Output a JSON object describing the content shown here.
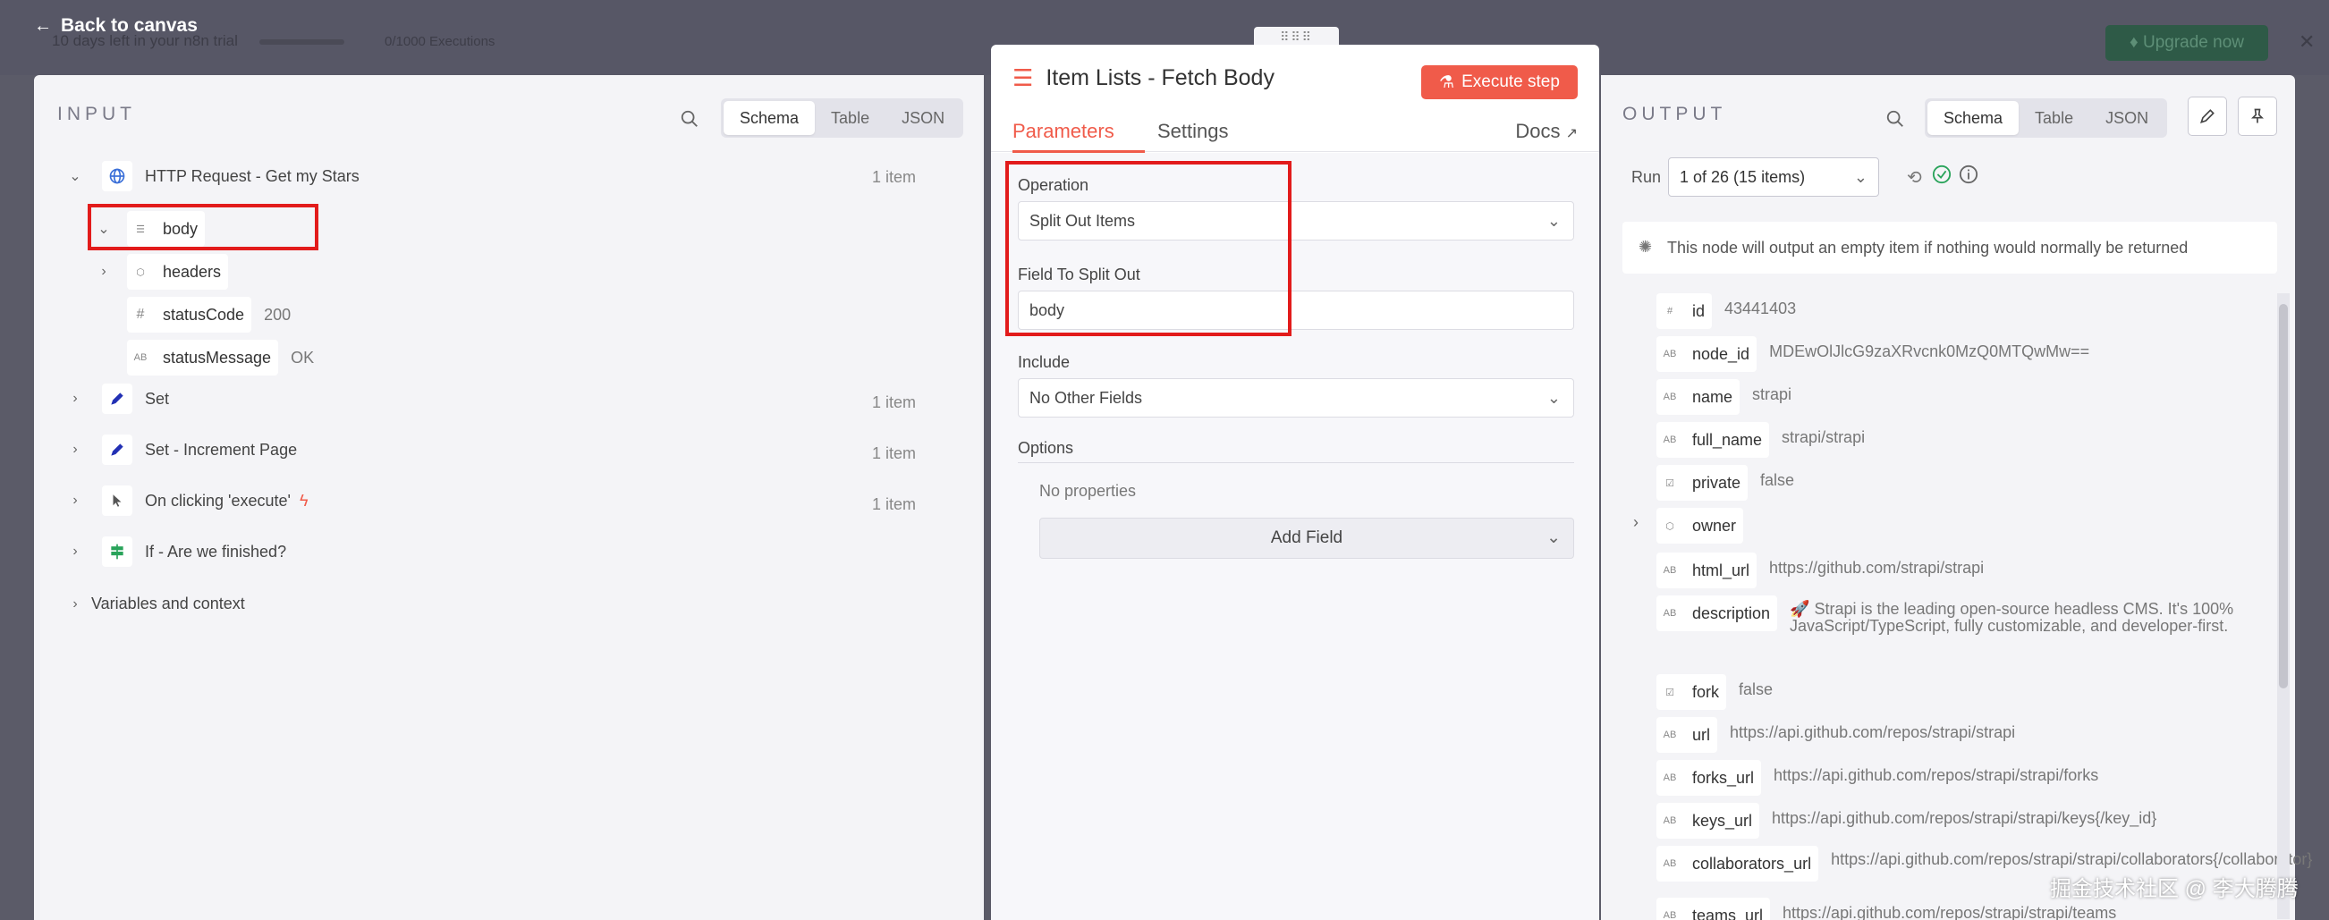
{
  "background": {
    "trial_text": "10 days left in your n8n trial",
    "executions_text": "0/1000 Executions",
    "upgrade_label": "Upgrade now"
  },
  "back_label": "Back to canvas",
  "input": {
    "title": "INPUT",
    "view_tabs": [
      "Schema",
      "Table",
      "JSON"
    ],
    "nodes": [
      {
        "name": "HTTP Request - Get my Stars",
        "count": "1 item"
      },
      {
        "name": "Set",
        "count": "1 item"
      },
      {
        "name": "Set - Increment Page",
        "count": "1 item"
      },
      {
        "name": "On clicking 'execute'",
        "count": "1 item"
      },
      {
        "name": "If - Are we finished?",
        "count": ""
      }
    ],
    "fields": [
      {
        "name": "body",
        "value": ""
      },
      {
        "name": "headers",
        "value": ""
      },
      {
        "name": "statusCode",
        "value": "200"
      },
      {
        "name": "statusMessage",
        "value": "OK"
      }
    ],
    "variables_label": "Variables and context"
  },
  "node": {
    "title": "Item Lists - Fetch Body",
    "execute_label": "Execute step",
    "tabs": [
      "Parameters",
      "Settings"
    ],
    "docs_label": "Docs",
    "operation_label": "Operation",
    "operation_value": "Split Out Items",
    "field_label": "Field To Split Out",
    "field_value": "body",
    "include_label": "Include",
    "include_value": "No Other Fields",
    "options_label": "Options",
    "no_properties": "No properties",
    "add_field_label": "Add Field"
  },
  "output": {
    "title": "OUTPUT",
    "view_tabs": [
      "Schema",
      "Table",
      "JSON"
    ],
    "run_label": "Run",
    "run_value": "1 of 26 (15 items)",
    "notice": "This node will output an empty item if nothing would returned",
    "notice_full": "This node will output an empty item if nothing would normally be returned",
    "rows": [
      {
        "key": "id",
        "type": "#",
        "value": "43441403"
      },
      {
        "key": "node_id",
        "type": "AB",
        "value": "MDEwOlJlcG9zaXRvcnk0MzQ0MTQwMw=="
      },
      {
        "key": "name",
        "type": "AB",
        "value": "strapi"
      },
      {
        "key": "full_name",
        "type": "AB",
        "value": "strapi/strapi"
      },
      {
        "key": "private",
        "type": "☑",
        "value": "false"
      },
      {
        "key": "owner",
        "type": "⬡",
        "value": ""
      },
      {
        "key": "html_url",
        "type": "AB",
        "value": "https://github.com/strapi/strapi"
      },
      {
        "key": "description",
        "type": "AB",
        "value": "🚀 Strapi is the leading open-source headless CMS. It's 100% JavaScript/TypeScript, fully customizable, and developer-first."
      },
      {
        "key": "fork",
        "type": "☑",
        "value": "false"
      },
      {
        "key": "url",
        "type": "AB",
        "value": "https://api.github.com/repos/strapi/strapi"
      },
      {
        "key": "forks_url",
        "type": "AB",
        "value": "https://api.github.com/repos/strapi/strapi/forks"
      },
      {
        "key": "keys_url",
        "type": "AB",
        "value": "https://api.github.com/repos/strapi/strapi/keys{/key_id}"
      },
      {
        "key": "collaborators_url",
        "type": "AB",
        "value": "https://api.github.com/repos/strapi/strapi/collaborators{/collaborator}"
      },
      {
        "key": "teams_url",
        "type": "AB",
        "value": "https://api.github.com/repos/strapi/strapi/teams"
      }
    ]
  },
  "watermark": "掘金技术社区 @ 李大腾腾",
  "colors": {
    "accent": "#f05b4a",
    "highlight": "#e21b1b",
    "success": "#29a35a"
  }
}
